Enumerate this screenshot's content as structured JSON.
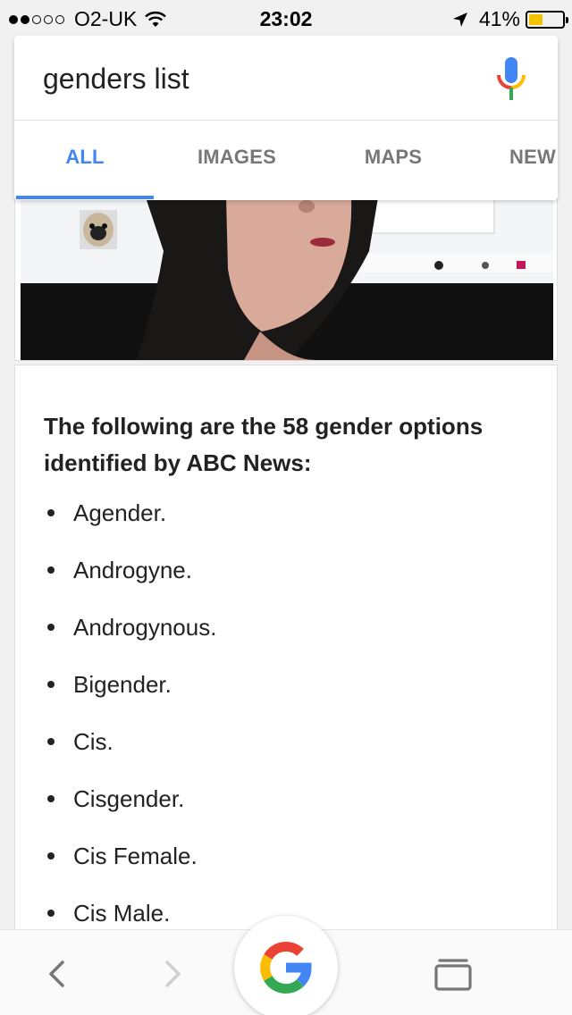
{
  "status_bar": {
    "carrier": "O2-UK",
    "time": "23:02",
    "battery_percent": "41%",
    "battery_level": 0.41,
    "signal_bars_filled": 2,
    "signal_bars_total": 5,
    "battery_color": "#f5c400"
  },
  "search": {
    "query": "genders list",
    "mic_icon": "microphone-icon"
  },
  "tabs": {
    "items": [
      {
        "label": "ALL",
        "active": true
      },
      {
        "label": "IMAGES",
        "active": false
      },
      {
        "label": "MAPS",
        "active": false
      },
      {
        "label": "NEW",
        "active": false
      }
    ],
    "accent_color": "#4285f4"
  },
  "result": {
    "heading": "The following are the 58 gender options identified by ABC News:",
    "items": [
      "Agender.",
      "Androgyne.",
      "Androgynous.",
      "Bigender.",
      "Cis.",
      "Cisgender.",
      "Cis Female.",
      "Cis Male."
    ]
  },
  "bottom_bar": {
    "back_icon": "chevron-left-icon",
    "forward_icon": "chevron-right-icon",
    "home_icon": "google-g-icon",
    "tabs_icon": "tabs-icon"
  }
}
